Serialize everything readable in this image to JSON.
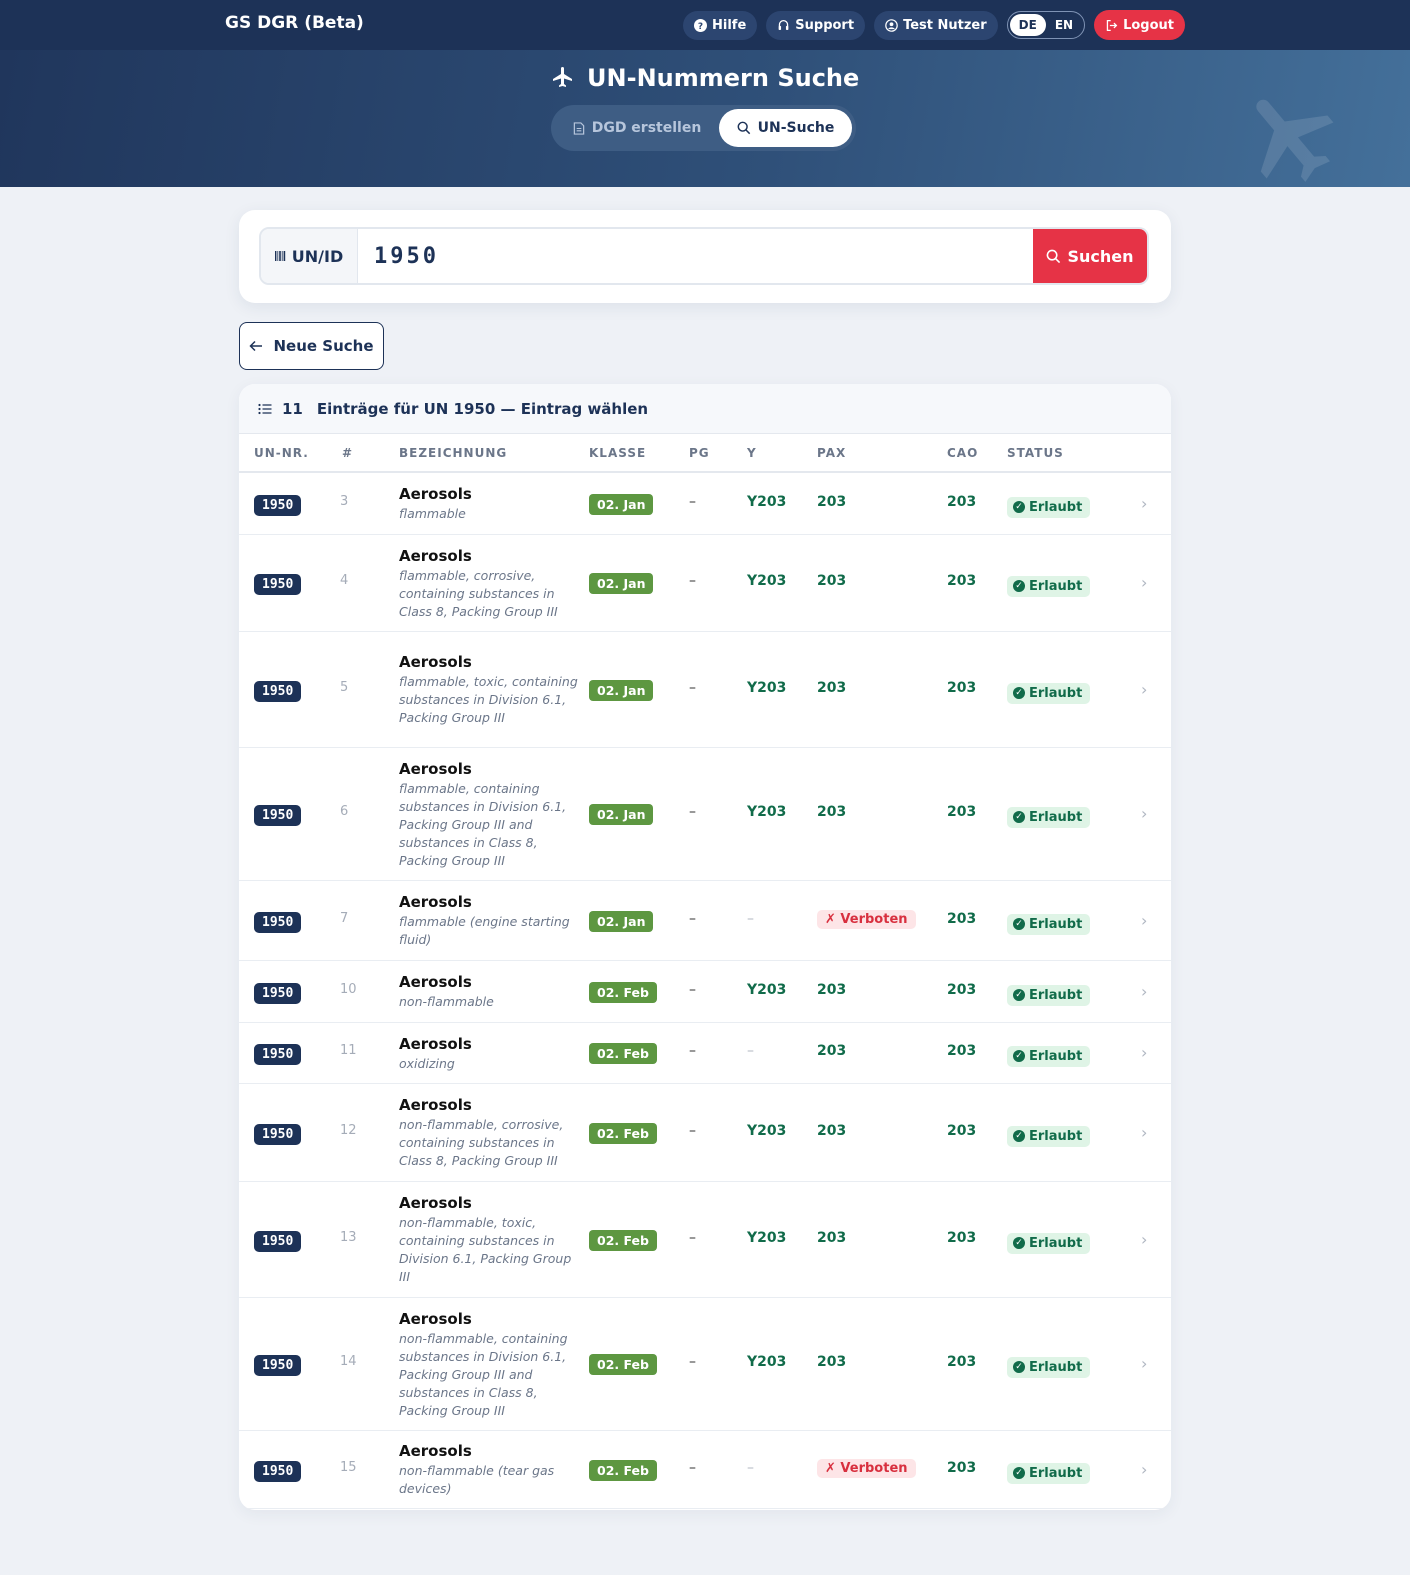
{
  "header": {
    "brand": "GS DGR (Beta)",
    "nav": {
      "help": "Hilfe",
      "support": "Support",
      "user": "Test Nutzer",
      "logout": "Logout"
    },
    "lang": {
      "de": "DE",
      "en": "EN",
      "active": "DE"
    }
  },
  "hero": {
    "title": "UN-Nummern Suche",
    "tabs": [
      {
        "label": "DGD erstellen"
      },
      {
        "label": "UN-Suche"
      }
    ]
  },
  "search": {
    "prefix": "UN/ID",
    "value": "1950",
    "button": "Suchen"
  },
  "back_button": "Neue Suche",
  "results": {
    "count": "11",
    "heading": "Einträge für UN 1950 — Eintrag wählen",
    "columns": {
      "un": "UN-NR.",
      "idx": "#",
      "desc": "BEZEICHNUNG",
      "class": "KLASSE",
      "pg": "PG",
      "y": "Y",
      "pax": "PAX",
      "cao": "CAO",
      "status": "STATUS"
    },
    "rows": [
      {
        "un": "1950",
        "idx": "3",
        "name": "Aerosols",
        "sub": "flammable",
        "class": "02. Jan",
        "pg": "–",
        "y": "Y203",
        "pax": "203",
        "pax_forbidden": false,
        "cao": "203",
        "status": "Erlaubt"
      },
      {
        "un": "1950",
        "idx": "4",
        "name": "Aerosols",
        "sub": "flammable, corrosive, containing substances in Class 8, Packing Group III",
        "class": "02. Jan",
        "pg": "–",
        "y": "Y203",
        "pax": "203",
        "pax_forbidden": false,
        "cao": "203",
        "status": "Erlaubt"
      },
      {
        "un": "1950",
        "idx": "5",
        "name": "Aerosols",
        "sub": "flammable, toxic, containing substances in Division 6.1, Packing Group III",
        "class": "02. Jan",
        "pg": "–",
        "y": "Y203",
        "pax": "203",
        "pax_forbidden": false,
        "cao": "203",
        "status": "Erlaubt"
      },
      {
        "un": "1950",
        "idx": "6",
        "name": "Aerosols",
        "sub": "flammable, containing substances in Division 6.1, Packing Group III and substances in Class 8, Packing Group III",
        "class": "02. Jan",
        "pg": "–",
        "y": "Y203",
        "pax": "203",
        "pax_forbidden": false,
        "cao": "203",
        "status": "Erlaubt"
      },
      {
        "un": "1950",
        "idx": "7",
        "name": "Aerosols",
        "sub": "flammable (engine starting fluid)",
        "class": "02. Jan",
        "pg": "–",
        "y": "–",
        "pax": "✗ Verboten",
        "pax_forbidden": true,
        "cao": "203",
        "status": "Erlaubt"
      },
      {
        "un": "1950",
        "idx": "10",
        "name": "Aerosols",
        "sub": "non-flammable",
        "class": "02. Feb",
        "pg": "–",
        "y": "Y203",
        "pax": "203",
        "pax_forbidden": false,
        "cao": "203",
        "status": "Erlaubt"
      },
      {
        "un": "1950",
        "idx": "11",
        "name": "Aerosols",
        "sub": "oxidizing",
        "class": "02. Feb",
        "pg": "–",
        "y": "–",
        "pax": "203",
        "pax_forbidden": false,
        "cao": "203",
        "status": "Erlaubt"
      },
      {
        "un": "1950",
        "idx": "12",
        "name": "Aerosols",
        "sub": "non-flammable, corrosive, containing substances in Class 8, Packing Group III",
        "class": "02. Feb",
        "pg": "–",
        "y": "Y203",
        "pax": "203",
        "pax_forbidden": false,
        "cao": "203",
        "status": "Erlaubt"
      },
      {
        "un": "1950",
        "idx": "13",
        "name": "Aerosols",
        "sub": "non-flammable, toxic, containing substances in Division 6.1, Packing Group III",
        "class": "02. Feb",
        "pg": "–",
        "y": "Y203",
        "pax": "203",
        "pax_forbidden": false,
        "cao": "203",
        "status": "Erlaubt"
      },
      {
        "un": "1950",
        "idx": "14",
        "name": "Aerosols",
        "sub": "non-flammable, containing substances in Division 6.1, Packing Group III and substances in Class 8, Packing Group III",
        "class": "02. Feb",
        "pg": "–",
        "y": "Y203",
        "pax": "203",
        "pax_forbidden": false,
        "cao": "203",
        "status": "Erlaubt"
      },
      {
        "un": "1950",
        "idx": "15",
        "name": "Aerosols",
        "sub": "non-flammable (tear gas devices)",
        "class": "02. Feb",
        "pg": "–",
        "y": "–",
        "pax": "✗ Verboten",
        "pax_forbidden": true,
        "cao": "203",
        "status": "Erlaubt"
      }
    ]
  },
  "colors": {
    "navy": "#1d3257",
    "accent_red": "#e63346",
    "class_green": "#5d9741",
    "ok_green": "#116b4a",
    "ok_bg": "#dff4e6",
    "forbidden_bg": "#fde5e7"
  },
  "icons": {
    "help": "question-circle-icon",
    "support": "headset-icon",
    "user": "user-circle-icon",
    "logout": "logout-icon",
    "plane": "airplane-icon",
    "doc": "document-icon",
    "search": "search-icon",
    "barcode": "barcode-icon",
    "back": "arrow-left-icon",
    "list": "list-icon",
    "check": "check-circle-icon",
    "chevron": "chevron-right-icon"
  }
}
